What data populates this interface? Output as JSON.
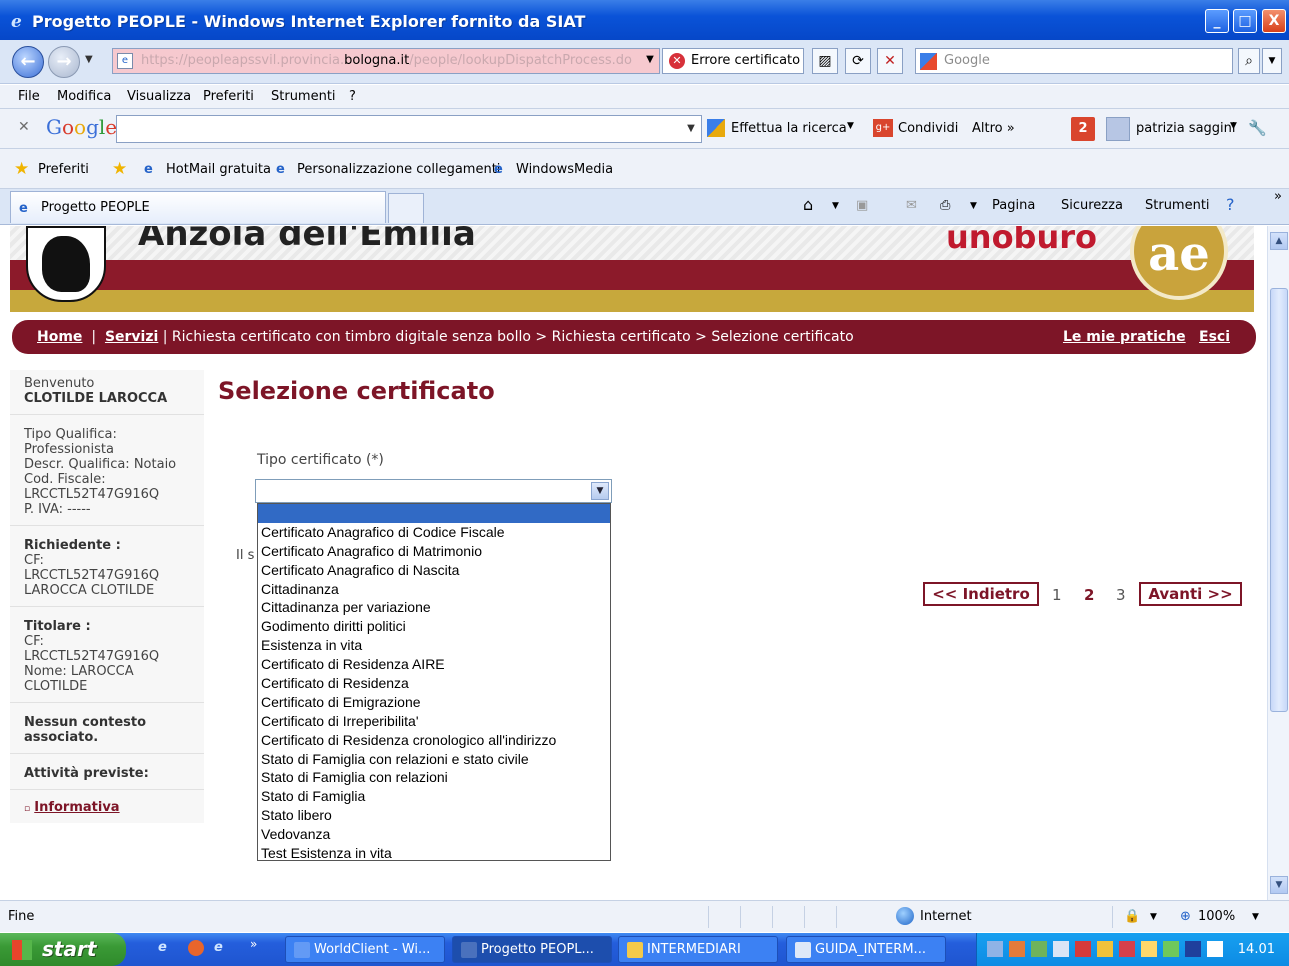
{
  "window": {
    "title": "Progetto PEOPLE - Windows Internet Explorer fornito da SIAT",
    "minimize": "_",
    "maximize": "□",
    "close": "X"
  },
  "address_bar": {
    "url_prefix": "https://peopleapssvil.provincia.",
    "url_domain": "bologna.it",
    "url_suffix": "/people/lookupDispatchProcess.do",
    "cert_error": "Errore certificato",
    "search_placeholder": "Google"
  },
  "menu": [
    "File",
    "Modifica",
    "Visualizza",
    "Preferiti",
    "Strumenti",
    "?"
  ],
  "google_toolbar": {
    "logo": "Google",
    "search_button": "Effettua la ricerca",
    "share": "Condividi",
    "more": "Altro »",
    "notifications": "2",
    "user": "patrizia saggini"
  },
  "favorites_bar": {
    "favorites": "Preferiti",
    "links": [
      "HotMail gratuita",
      "Personalizzazione collegamenti",
      "WindowsMedia"
    ]
  },
  "tab": {
    "title": "Progetto PEOPLE",
    "commands": [
      "Pagina",
      "Sicurezza",
      "Strumenti"
    ]
  },
  "page": {
    "town": "Anzola dell'Emilia",
    "logo_right": "ae",
    "logo_red": "unoburo",
    "breadcrumb": {
      "home": "Home",
      "services": "Servizi",
      "path": "| Richiesta certificato con timbro digitale senza bollo > Richiesta certificato > Selezione certificato",
      "my_practices": "Le mie pratiche",
      "exit": "Esci"
    },
    "sidebar": {
      "welcome": "Benvenuto",
      "user_name": "CLOTILDE LAROCCA",
      "qualifica_lines": [
        "Tipo Qualifica:",
        "Professionista",
        "Descr. Qualifica: Notaio",
        "Cod. Fiscale:",
        "LRCCTL52T47G916Q",
        "P. IVA: -----"
      ],
      "requester_title": "Richiedente :",
      "requester_lines": [
        "CF:",
        "LRCCTL52T47G916Q",
        "LAROCCA CLOTILDE"
      ],
      "holder_title": "Titolare :",
      "holder_lines": [
        "CF:",
        "LRCCTL52T47G916Q",
        "Nome: LAROCCA",
        "CLOTILDE"
      ],
      "no_context": "Nessun contesto associato.",
      "activities": "Attività previste:",
      "info_link": "Informativa"
    },
    "heading": "Selezione certificato",
    "field_label": "Tipo certificato (*)",
    "hidden_text_fragment": "Il s",
    "dropdown_options": [
      "",
      "Certificato Anagrafico di Codice Fiscale",
      "Certificato Anagrafico di Matrimonio",
      "Certificato Anagrafico di Nascita",
      "Cittadinanza",
      "Cittadinanza per variazione",
      "Godimento diritti politici",
      "Esistenza in vita",
      "Certificato di Residenza AIRE",
      "Certificato di Residenza",
      "Certificato di Emigrazione",
      "Certificato di Irreperibilita'",
      "Certificato di Residenza cronologico all'indirizzo",
      "Stato di Famiglia con relazioni e stato civile",
      "Stato di Famiglia con relazioni",
      "Stato di Famiglia",
      "Stato libero",
      "Vedovanza",
      "Test Esistenza in vita"
    ],
    "pager": {
      "back": "<< Indietro",
      "pages": [
        "1",
        "2",
        "3"
      ],
      "current": "2",
      "next": "Avanti >>"
    }
  },
  "status_bar": {
    "status": "Fine",
    "zone": "Internet",
    "zoom": "100%"
  },
  "taskbar": {
    "start": "start",
    "tasks": [
      "WorldClient - Wi...",
      "Progetto PEOPL...",
      "INTERMEDIARI",
      "GUIDA_INTERM..."
    ],
    "active_task": "Progetto PEOPL...",
    "clock": "14.01"
  }
}
